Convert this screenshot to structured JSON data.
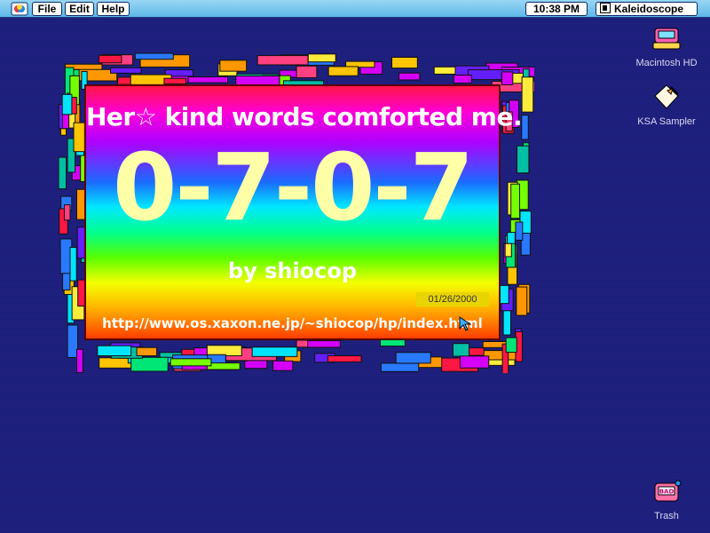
{
  "menubar": {
    "apple_icon": "apple-menu-icon",
    "items": [
      {
        "label": "File"
      },
      {
        "label": "Edit"
      },
      {
        "label": "Help"
      }
    ],
    "clock": "10:38 PM",
    "app_name": "Kaleidoscope",
    "colors": {
      "bar": "#6fc3ee",
      "desktop": "#1e1f7a"
    }
  },
  "desktop_icons": [
    {
      "label": "Macintosh HD",
      "icon": "hard-drive-icon"
    },
    {
      "label": "KSA Sampler",
      "icon": "ksa-sampler-icon"
    },
    {
      "label": "Trash",
      "icon": "trash-icon"
    }
  ],
  "artwork": {
    "headline": "Her☆ kind words comforted me.",
    "big_text": "0-7-0-7",
    "byline": "by shiocop",
    "date": "01/26/2000",
    "url": "http://www.os.xaxon.ne.jp/~shiocop/hp/index.html",
    "colors": {
      "number": "#ffffa8",
      "date_bg": "#e8d400"
    }
  }
}
